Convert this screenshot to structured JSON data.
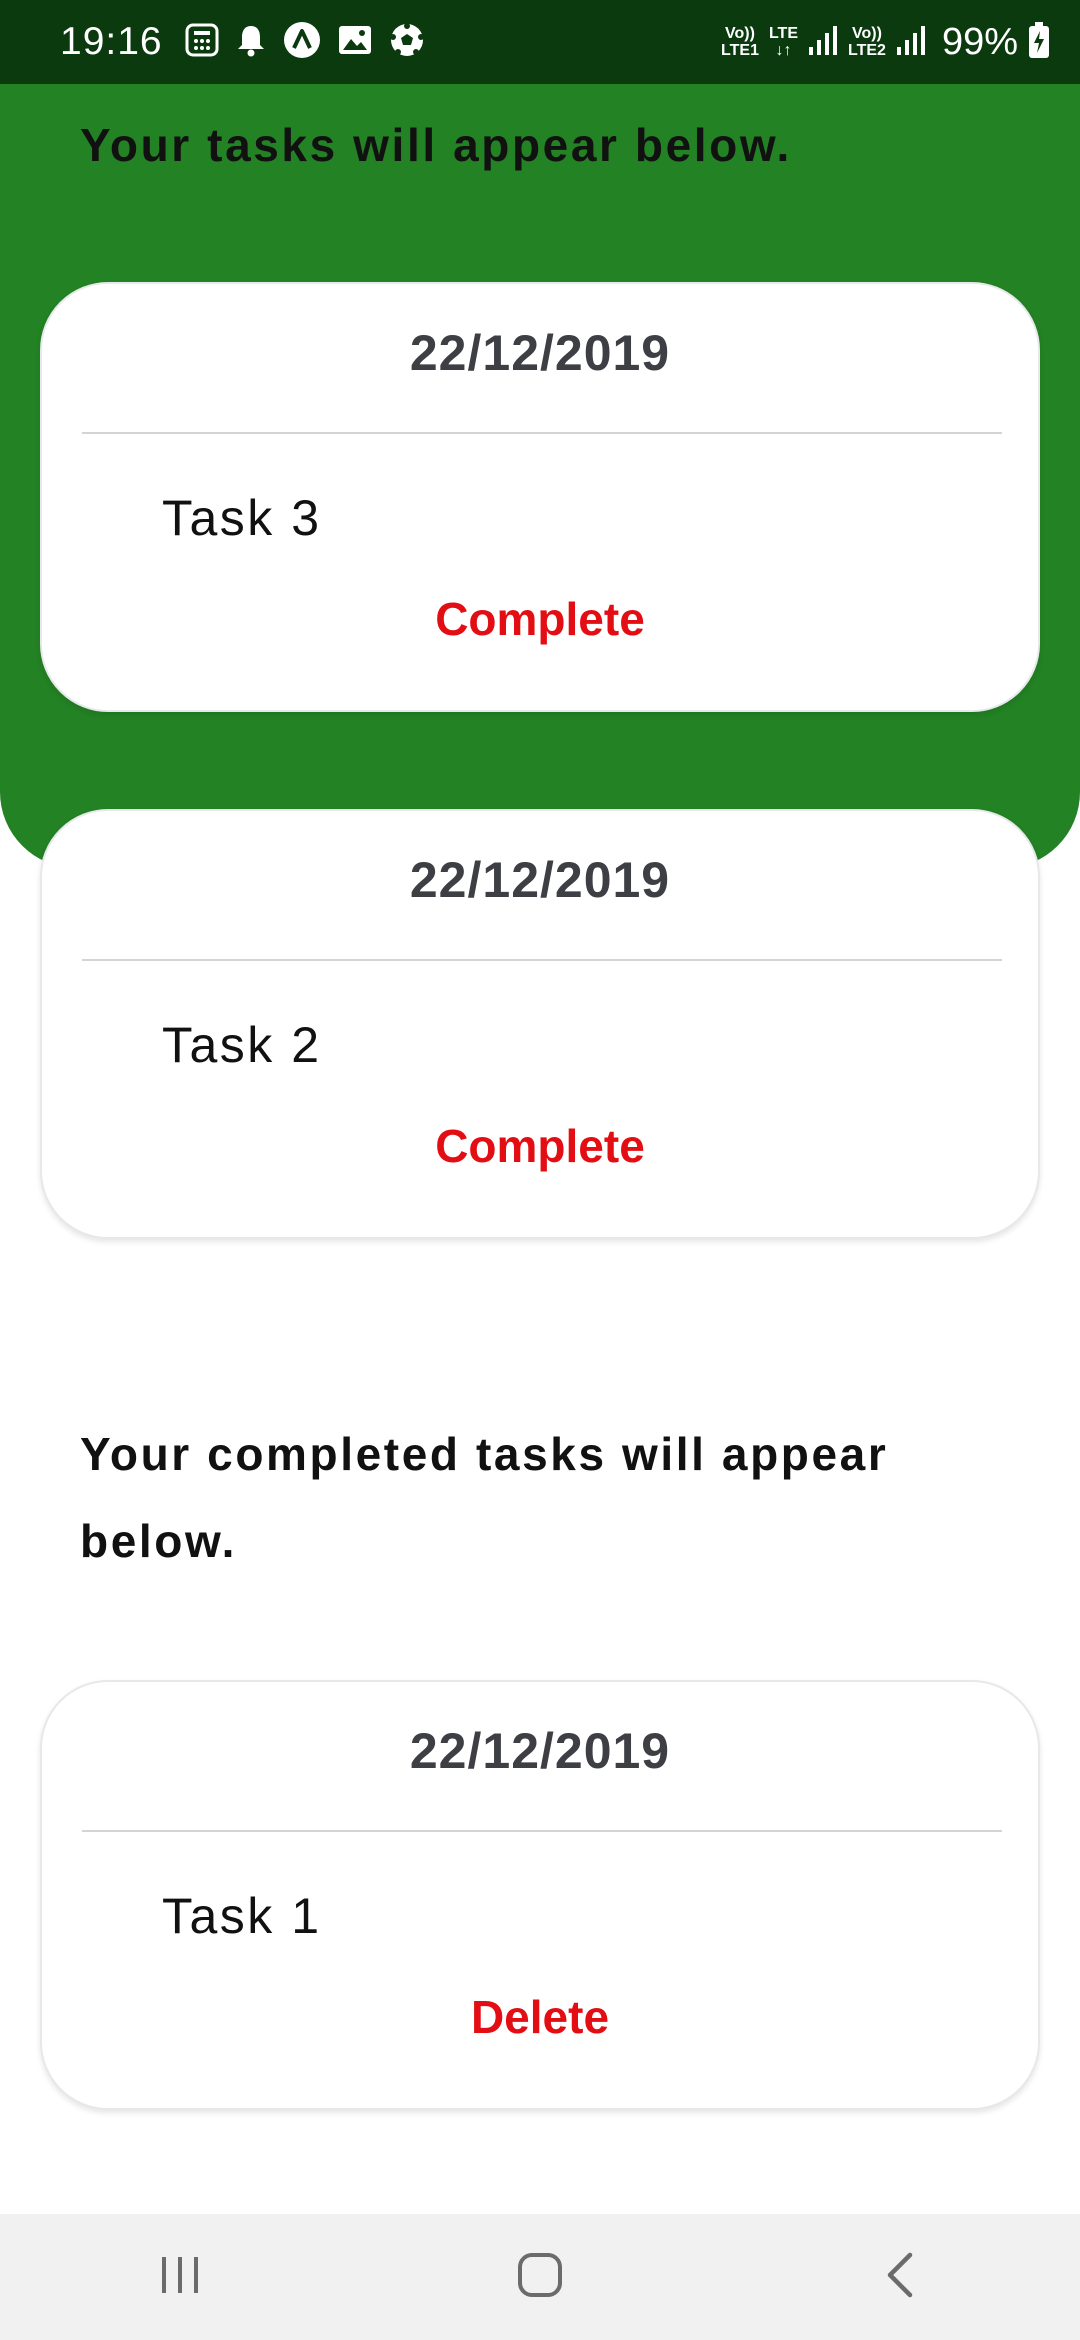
{
  "status_bar": {
    "time": "19:16",
    "left_icons": [
      "calculator-icon",
      "bell-icon",
      "app-a-icon",
      "image-icon",
      "football-icon"
    ],
    "sim1_top": "Vo))",
    "sim1_bottom": "LTE1",
    "lte_top": "LTE",
    "lte_bottom": "↓↑",
    "sim2_top": "Vo))",
    "sim2_bottom": "LTE2",
    "battery": "99%"
  },
  "pending": {
    "heading": "Your tasks will appear below.",
    "cards": [
      {
        "date": "22/12/2019",
        "task": "Task 3",
        "action": "Complete"
      },
      {
        "date": "22/12/2019",
        "task": "Task 2",
        "action": "Complete"
      }
    ]
  },
  "completed": {
    "heading": "Your completed tasks will appear below.",
    "cards": [
      {
        "date": "22/12/2019",
        "task": "Task 1",
        "action": "Delete"
      }
    ]
  },
  "colors": {
    "status_bar": "#0b3a0f",
    "header_green": "#238224",
    "action_red": "#e30d14",
    "date_text": "#3d3f44",
    "nav_bar": "#f1f1f1"
  },
  "nav_bar": {
    "icons": [
      "recent-apps-icon",
      "home-icon",
      "back-icon"
    ]
  }
}
